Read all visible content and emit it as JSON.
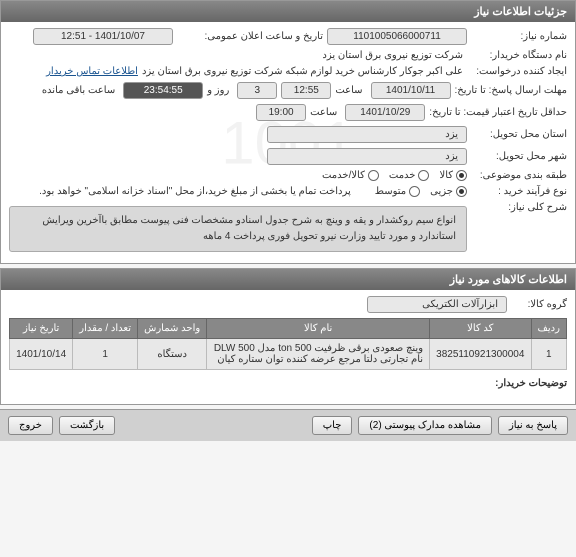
{
  "header": {
    "title": "جزئیات اطلاعات نیاز"
  },
  "fields": {
    "need_number_label": "شماره نیاز:",
    "need_number": "1101005066000711",
    "announce_datetime_label": "تاریخ و ساعت اعلان عمومی:",
    "announce_datetime": "1401/10/07 - 12:51",
    "buyer_org_label": "نام دستگاه خریدار:",
    "buyer_org": "شرکت توزیع نیروی برق استان یزد",
    "requester_label": "ایجاد کننده درخواست:",
    "requester": "علی اکبر جوکار  کارشناس خرید لوازم شبکه  شرکت توزیع نیروی برق استان یزد",
    "contact_link": "اطلاعات تماس خریدار",
    "deadline_label": "مهلت ارسال پاسخ: تا تاریخ:",
    "deadline_date": "1401/10/11",
    "deadline_time_label": "ساعت",
    "deadline_time": "12:55",
    "days_label": "روز و",
    "days": "3",
    "remaining_time": "23:54:55",
    "remaining_label": "ساعت باقی مانده",
    "validity_label": "حداقل تاریخ اعتبار قیمت: تا تاریخ:",
    "validity_date": "1401/10/29",
    "validity_time_label": "ساعت",
    "validity_time": "19:00",
    "city_label": "استان محل تحویل:",
    "city": "یزد",
    "province_label": "شهر محل تحویل:",
    "province": "یزد",
    "need_type_label": "طبقه بندی موضوعی:",
    "buy_process_label": "نوع فرآیند خرید :",
    "payment_note": "پرداخت تمام یا بخشی از مبلغ خرید،از محل \"اسناد خزانه اسلامی\" خواهد بود.",
    "need_desc_label": "شرح کلی نیاز:",
    "need_desc": "انواع سیم روکشدار و یقه و وینچ  به شرح جدول اسنادو مشخصات فنی  پیوست مطابق باآخرین ویرایش استاندارد و مورد تایید وزارت نیرو تحویل فوری پرداخت 4 ماهه",
    "goods_header": "اطلاعات کالاهای مورد نیاز",
    "goods_group_label": "گروه کالا:",
    "goods_group": "ابزارآلات الکتریکی",
    "buyer_notes_label": "توضیحات خریدار:"
  },
  "radios": {
    "type": {
      "options": [
        "کالا",
        "خدمت",
        "کالا/خدمت"
      ],
      "selected": 0
    },
    "process": {
      "options": [
        "جزیی",
        "متوسط"
      ],
      "selected": 0
    }
  },
  "table": {
    "headers": [
      "ردیف",
      "کد کالا",
      "نام کالا",
      "واحد شمارش",
      "تعداد / مقدار",
      "تاریخ نیاز"
    ],
    "rows": [
      {
        "idx": "1",
        "code": "3825110921300004",
        "name": "وینچ صعودی برقی ظرفیت 500 ton مدل DLW 500 نام تجارتی دلتا مرجع عرضه کننده توان ستاره کیان",
        "unit": "دستگاه",
        "qty": "1",
        "date": "1401/10/14"
      }
    ]
  },
  "buttons": {
    "reply": "پاسخ به نیاز",
    "attachments": "مشاهده مدارک پیوستی (2)",
    "print": "چاپ",
    "back": "بازگشت",
    "exit": "خروج"
  },
  "watermark": "1001"
}
